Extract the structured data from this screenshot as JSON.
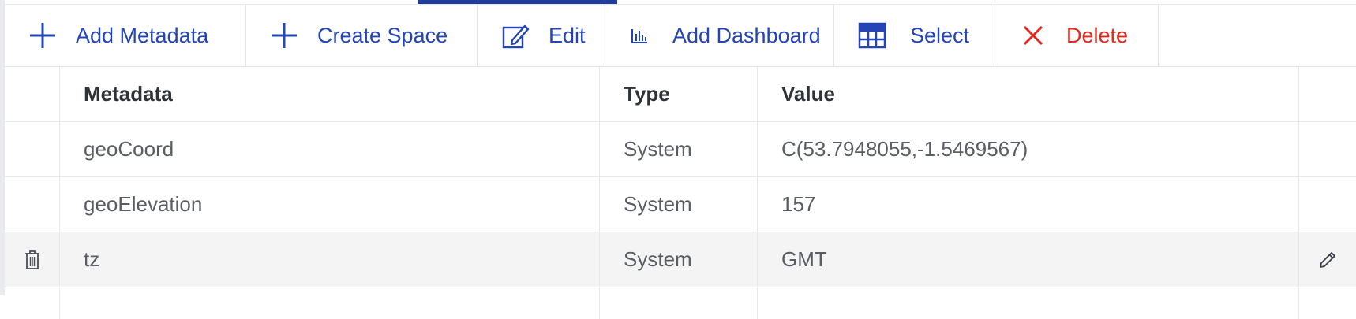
{
  "toolbar": {
    "buttons": [
      {
        "label": "Add Metadata",
        "icon": "plus-icon"
      },
      {
        "label": "Create Space",
        "icon": "plus-icon"
      },
      {
        "label": "Edit",
        "icon": "edit-icon"
      },
      {
        "label": "Add Dashboard",
        "icon": "bar-chart-icon"
      },
      {
        "label": "Select",
        "icon": "grid-select-icon"
      },
      {
        "label": "Delete",
        "icon": "close-icon"
      }
    ]
  },
  "colors": {
    "accent": "#2445b5",
    "danger": "#e0281e",
    "active_tab": "#1f3c9e",
    "row_highlight": "#f4f4f4"
  },
  "table": {
    "columns": [
      "Metadata",
      "Type",
      "Value"
    ],
    "rows": [
      {
        "metadata": "geoCoord",
        "type": "System",
        "value": "C(53.7948055,-1.5469567)"
      },
      {
        "metadata": "geoElevation",
        "type": "System",
        "value": "157"
      },
      {
        "metadata": "tz",
        "type": "System",
        "value": "GMT",
        "hovered": true
      }
    ]
  }
}
